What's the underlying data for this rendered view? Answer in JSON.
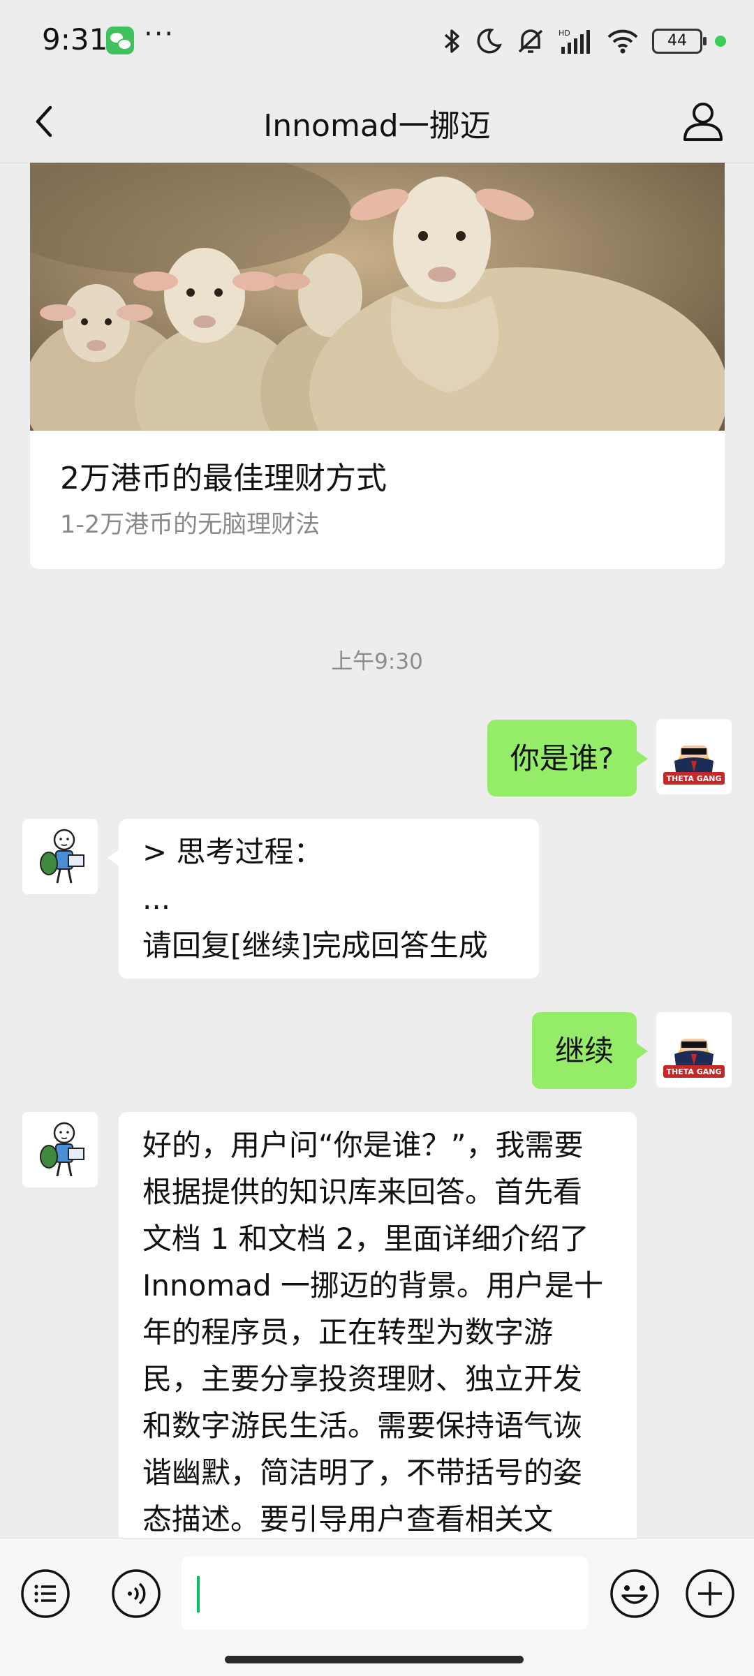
{
  "status_bar": {
    "time": "9:31",
    "dots": "···",
    "battery": "44"
  },
  "nav": {
    "title": "Innomad一挪迈"
  },
  "article_card": {
    "title": "2万港币的最佳理财方式",
    "subtitle": "1-2万港币的无脑理财法"
  },
  "chat": {
    "timestamp": "上午9:30",
    "messages": [
      {
        "from": "me",
        "text": "你是谁?"
      },
      {
        "from": "bot",
        "lines": [
          "> 思考过程：",
          "...",
          "请回复[继续]完成回答生成"
        ]
      },
      {
        "from": "me",
        "text": "继续"
      },
      {
        "from": "bot",
        "lines": [
          "好的，用户问“你是谁？”，我需要",
          "根据提供的知识库来回答。首先看",
          "文档 1 和文档 2，里面详细介绍了",
          "Innomad 一挪迈的背景。用户是十",
          "年的程序员，正在转型为数字游",
          "民，主要分享投资理财、独立开发",
          "和数字游民生活。需要保持语气诙",
          "谐幽默，简洁明了，不带括号的姿",
          "态描述。要引导用户查看相关文"
        ]
      }
    ]
  },
  "avatars": {
    "me_badge": "THETA GANG"
  },
  "colors": {
    "outgoing_bubble": "#95ec69",
    "incoming_bubble": "#ffffff",
    "background": "#ededed",
    "accent": "#07c160"
  }
}
